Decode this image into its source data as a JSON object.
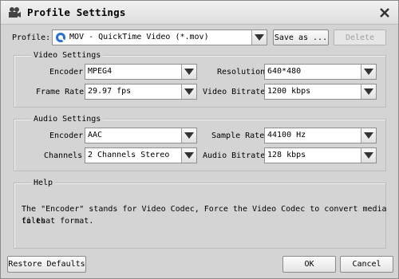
{
  "window": {
    "title": "Profile Settings"
  },
  "profile": {
    "label": "Profile:",
    "value": "MOV - QuickTime Video (*.mov)",
    "save_as_label": "Save as ...",
    "delete_label": "Delete"
  },
  "video": {
    "group_title": "Video Settings",
    "encoder_label": "Encoder",
    "encoder_value": "MPEG4",
    "resolution_label": "Resolution",
    "resolution_value": "640*480",
    "frame_rate_label": "Frame Rate",
    "frame_rate_value": "29.97 fps",
    "bitrate_label": "Video Bitrate",
    "bitrate_value": "1200 kbps"
  },
  "audio": {
    "group_title": "Audio Settings",
    "encoder_label": "Encoder",
    "encoder_value": "AAC",
    "sample_rate_label": "Sample Rate",
    "sample_rate_value": "44100 Hz",
    "channels_label": "Channels",
    "channels_value": "2 Channels Stereo",
    "bitrate_label": "Audio Bitrate",
    "bitrate_value": "128 kbps"
  },
  "help": {
    "group_title": "Help",
    "text_line1": "The \"Encoder\" stands for Video Codec, Force the Video Codec to convert media files",
    "text_line2": "to that format."
  },
  "footer": {
    "restore_label": "Restore Defaults",
    "ok_label": "OK",
    "cancel_label": "Cancel"
  },
  "colors": {
    "profile_icon": "#2a6fcf",
    "background": "#d4d4d4"
  }
}
